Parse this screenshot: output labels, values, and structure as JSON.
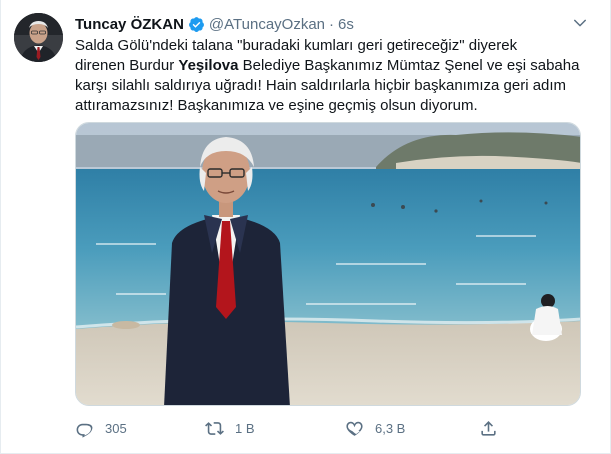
{
  "tweet": {
    "author": {
      "display_name": "Tuncay ÖZKAN",
      "handle": "@ATuncayOzkan",
      "verified": true,
      "avatar_icon": "profile-photo"
    },
    "separator": "·",
    "timestamp": "6s",
    "text": {
      "line1": "Salda Gölü'ndeki talana \"buradaki kumları geri getireceğiz\" diyerek",
      "line2_before": "direnen Burdur ",
      "line2_bold": "Yeşilova",
      "line2_after": " Belediye Başkanımız Mümtaz Şenel ve eşi sabaha",
      "line3": "karşı silahlı saldırıya uğradı! Hain saldırılarla hiçbir başkanımıza geri adım",
      "line4": "attıramazsınız! Başkanımıza ve eşine geçmiş olsun diyorum."
    },
    "media": {
      "description_icon": "photo-man-at-lakeshore"
    },
    "actions": {
      "reply_count": "305",
      "retweet_count": "1 B",
      "like_count": "6,3 B"
    },
    "colors": {
      "verified_blue": "#1d9bf0",
      "secondary_text": "#5b7083",
      "primary_text": "#0f1419"
    }
  }
}
